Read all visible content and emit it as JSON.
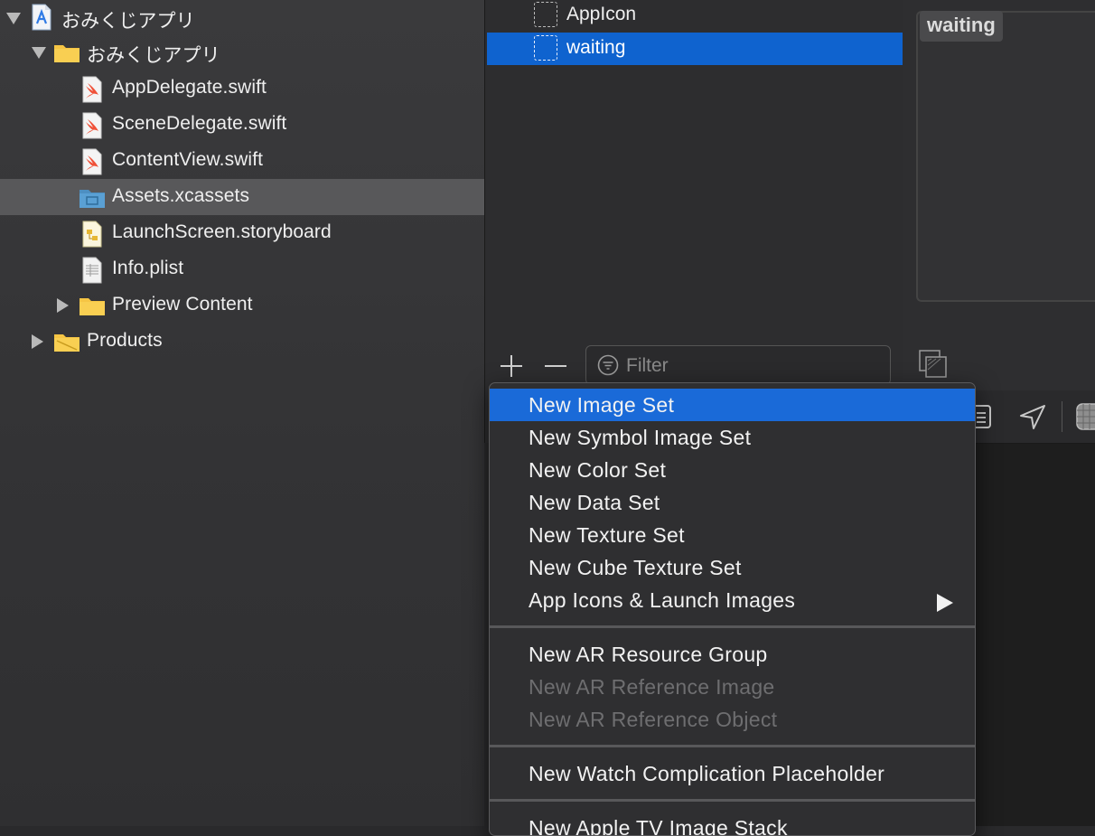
{
  "navigator": {
    "items": [
      {
        "label": "おみくじアプリ",
        "icon": "xcode-project-icon",
        "disclosure": "expanded"
      },
      {
        "label": "おみくじアプリ",
        "icon": "folder-icon",
        "disclosure": "expanded"
      },
      {
        "label": "AppDelegate.swift",
        "icon": "swift-file-icon"
      },
      {
        "label": "SceneDelegate.swift",
        "icon": "swift-file-icon"
      },
      {
        "label": "ContentView.swift",
        "icon": "swift-file-icon"
      },
      {
        "label": "Assets.xcassets",
        "icon": "asset-catalog-icon",
        "selected": true
      },
      {
        "label": "LaunchScreen.storyboard",
        "icon": "storyboard-file-icon"
      },
      {
        "label": "Info.plist",
        "icon": "plist-file-icon"
      },
      {
        "label": "Preview Content",
        "icon": "folder-icon",
        "disclosure": "collapsed"
      },
      {
        "label": "Products",
        "icon": "folder-icon",
        "disclosure": "collapsed"
      }
    ]
  },
  "asset_list": {
    "items": [
      {
        "label": "AppIcon",
        "selected": false
      },
      {
        "label": "waiting",
        "selected": true
      }
    ],
    "filter_placeholder": "Filter"
  },
  "detail": {
    "asset_name": "waiting"
  },
  "context_menu": {
    "groups": [
      [
        {
          "label": "New Image Set",
          "highlighted": true
        },
        {
          "label": "New Symbol Image Set"
        },
        {
          "label": "New Color Set"
        },
        {
          "label": "New Data Set"
        },
        {
          "label": "New Texture Set"
        },
        {
          "label": "New Cube Texture Set"
        },
        {
          "label": "App Icons & Launch Images",
          "submenu": true
        }
      ],
      [
        {
          "label": "New AR Resource Group"
        },
        {
          "label": "New AR Reference Image",
          "disabled": true
        },
        {
          "label": "New AR Reference Object",
          "disabled": true
        }
      ],
      [
        {
          "label": "New Watch Complication Placeholder"
        }
      ],
      [
        {
          "label": "New Apple TV Image Stack"
        }
      ]
    ]
  },
  "colors": {
    "selection_blue": "#0f63cf",
    "menu_highlight": "#1a6ad8",
    "navigator_selection": "#58585a",
    "folder_yellow": "#f6c544"
  }
}
